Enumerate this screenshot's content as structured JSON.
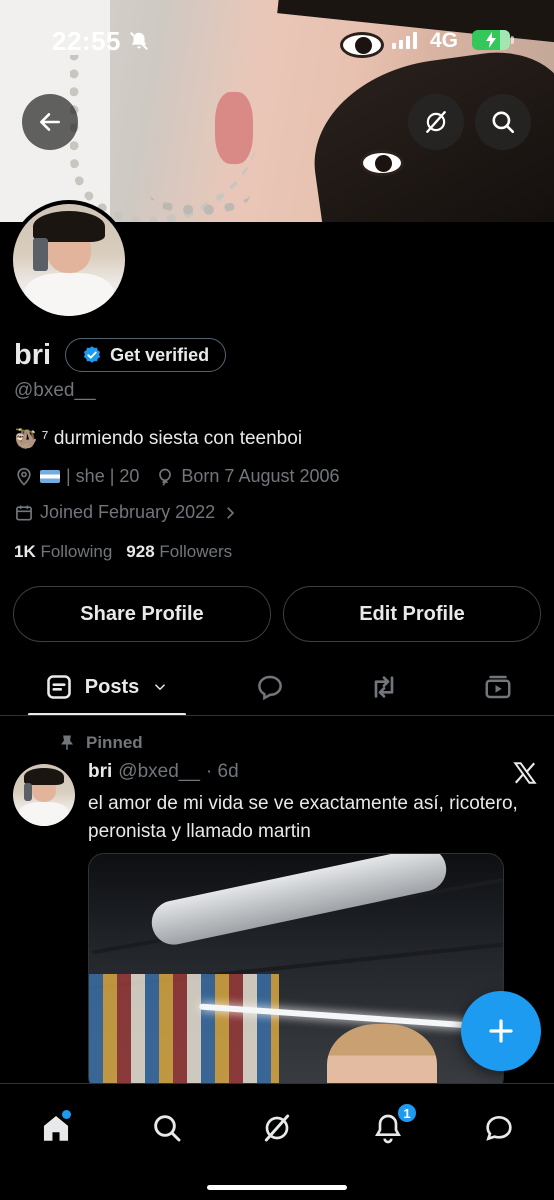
{
  "status_bar": {
    "time": "22:55",
    "network": "4G"
  },
  "profile": {
    "name": "bri",
    "get_verified_label": "Get verified",
    "handle": "@bxed__",
    "bio_text": "⁷ durmiendo siesta con teenboi",
    "location_text": "| she | 20",
    "birthday": "Born 7 August 2006",
    "joined": "Joined February 2022",
    "following_count": "1K",
    "following_label": "Following",
    "followers_count": "928",
    "followers_label": "Followers"
  },
  "actions": {
    "share_label": "Share Profile",
    "edit_label": "Edit Profile"
  },
  "tabs": {
    "posts_label": "Posts"
  },
  "pinned_post": {
    "pinned_label": "Pinned",
    "author_name": "bri",
    "author_handle": "@bxed__",
    "time": "· 6d",
    "text": "el amor de mi vida se ve exactamente así, ricotero, peronista y llamado martin"
  },
  "bottom_nav": {
    "notifications_badge": "1"
  },
  "colors": {
    "accent": "#1d9bf0",
    "muted": "#71767b",
    "text": "#e7e9ea",
    "background": "#000000"
  }
}
